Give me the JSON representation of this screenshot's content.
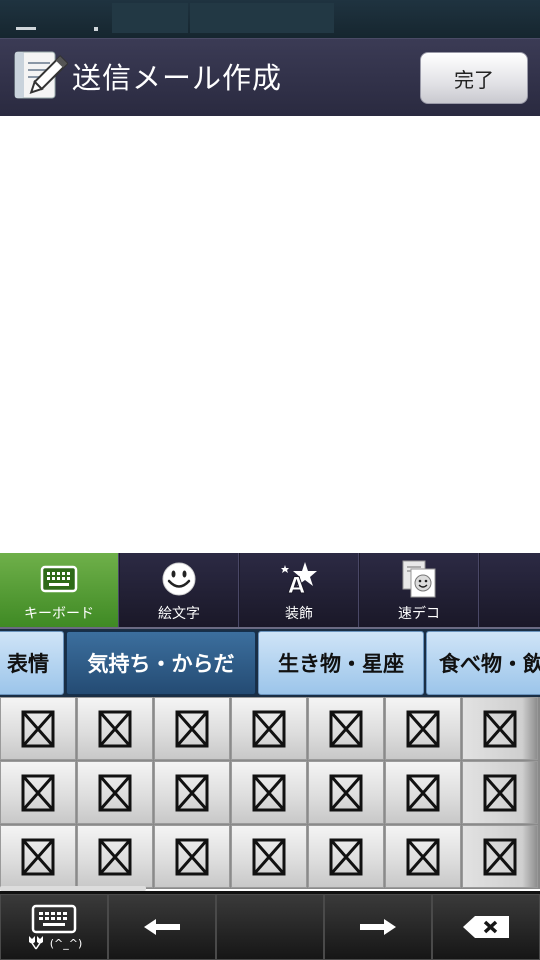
{
  "app": {
    "title": "送信メール作成",
    "done_label": "完了"
  },
  "tool_tabs": [
    {
      "label": "キーボード",
      "icon": "keyboard-icon",
      "active": true
    },
    {
      "label": "絵文字",
      "icon": "smiley-icon",
      "active": false
    },
    {
      "label": "装飾",
      "icon": "decoration-star-icon",
      "active": false
    },
    {
      "label": "速デコ",
      "icon": "quick-deco-icon",
      "active": false
    }
  ],
  "category_tabs": [
    {
      "label": "表情",
      "active": false
    },
    {
      "label": "気持ち・からだ",
      "active": true
    },
    {
      "label": "生き物・星座",
      "active": false
    },
    {
      "label": "食べ物・飲み物",
      "active": false
    }
  ],
  "emoji_grid": {
    "rows": 3,
    "cols": 7,
    "glyph": "missing-glyph-box"
  },
  "bottom_bar": {
    "keyboard_caption": "(^_^)",
    "keys": [
      "keyboard-switch-icon",
      "left-arrow-icon",
      "blank",
      "right-arrow-icon",
      "backspace-icon"
    ]
  },
  "colors": {
    "title_bar": "#2f2f48",
    "active_tool_tab": "#5a9e35",
    "active_category_tab": "#2f5b86",
    "category_tab": "#b7d6f2"
  }
}
